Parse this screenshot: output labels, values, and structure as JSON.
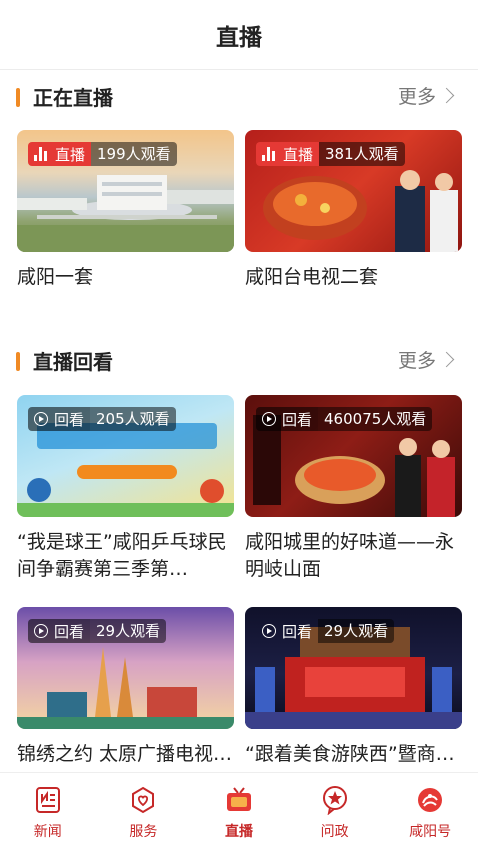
{
  "header": {
    "title": "直播"
  },
  "live": {
    "title": "正在直播",
    "more": "更多",
    "items": [
      {
        "badge": "直播",
        "viewers": "199人观看",
        "title": "咸阳一套"
      },
      {
        "badge": "直播",
        "viewers": "381人观看",
        "title": "咸阳台电视二套"
      }
    ]
  },
  "replay": {
    "title": "直播回看",
    "more": "更多",
    "items": [
      {
        "badge": "回看",
        "viewers": "205人观看",
        "title": "“我是球王”咸阳乒乓球民间争霸赛第三季第…"
      },
      {
        "badge": "回看",
        "viewers": "460075人观看",
        "title": "咸阳城里的好味道——永明岐山面"
      },
      {
        "badge": "回看",
        "viewers": "29人观看",
        "title": "锦绣之约 太原广播电视…"
      },
      {
        "badge": "回看",
        "viewers": "29人观看",
        "title": "“跟着美食游陕西”暨商…"
      }
    ]
  },
  "tabbar": {
    "tabs": [
      {
        "label": "新闻",
        "icon": "news-icon"
      },
      {
        "label": "服务",
        "icon": "service-icon"
      },
      {
        "label": "直播",
        "icon": "tv-icon"
      },
      {
        "label": "问政",
        "icon": "star-icon"
      },
      {
        "label": "咸阳号",
        "icon": "xianyang-logo-icon"
      }
    ],
    "active": "直播",
    "color": "#c62828"
  },
  "colors": {
    "accent": "#f08a24",
    "live_badge": "#e53935",
    "tab_red": "#c62828"
  }
}
